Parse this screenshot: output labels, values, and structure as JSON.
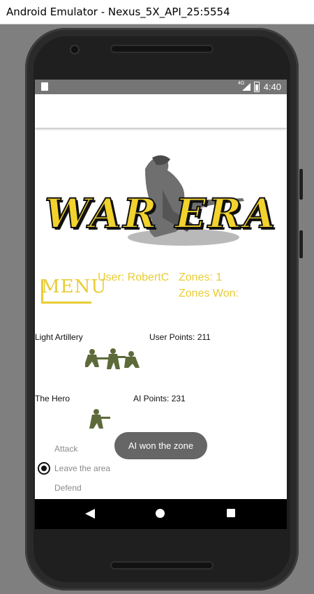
{
  "window": {
    "title": "Android Emulator - Nexus_5X_API_25:5554"
  },
  "status_bar": {
    "time": "4:40",
    "network": "4G",
    "icons": [
      "sd-card-icon",
      "signal-icon",
      "battery-icon"
    ]
  },
  "logo": {
    "text": "WAR ERA"
  },
  "menu": {
    "label": "MENU"
  },
  "stats": {
    "user": "User: RobertC",
    "zones": "Zones: 1",
    "zones_won": "Zones Won:"
  },
  "units": {
    "unit1_name": "Light Artillery",
    "user_points": "User Points: 211",
    "unit2_name": "The Hero",
    "ai_points": "AI Points: 231"
  },
  "options": {
    "attack": "Attack",
    "leave": "Leave the area",
    "defend": "Defend",
    "selected": "Leave the area"
  },
  "toast": {
    "message": "AI won the zone"
  },
  "nav": {
    "icons": [
      "back-icon",
      "home-icon",
      "recents-icon"
    ]
  },
  "colors": {
    "accent": "#e9cc35",
    "status_bar": "#757575",
    "toast_bg": "#666666"
  }
}
